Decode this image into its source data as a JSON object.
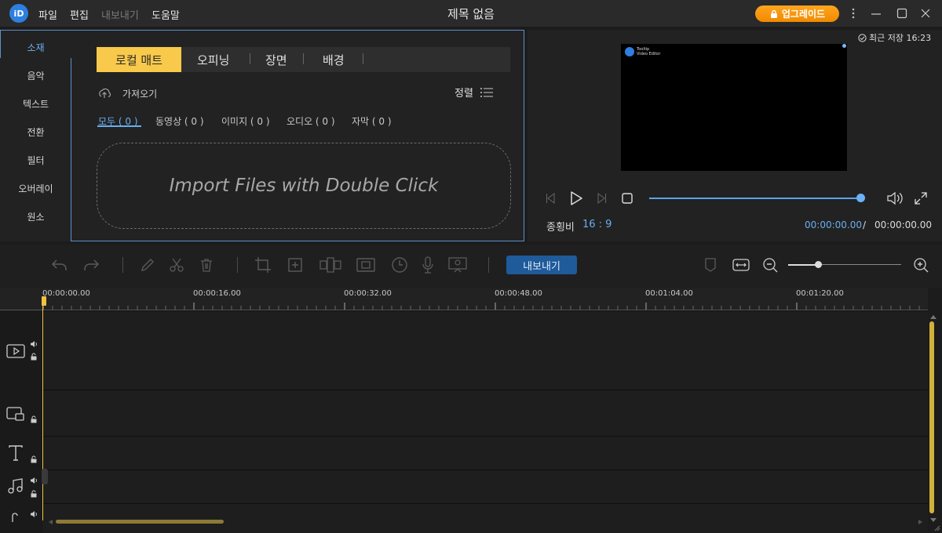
{
  "app": {
    "logo_text": "iD",
    "title": "제목 없음",
    "menu": [
      "파일",
      "편집",
      "내보내기",
      "도움말"
    ],
    "upgrade_label": "업그레이드"
  },
  "media": {
    "side_tabs": [
      "소재",
      "음악",
      "텍스트",
      "전환",
      "필터",
      "오버레이",
      "원소"
    ],
    "tabs": [
      "로컬 매트",
      "오피닝",
      "장면",
      "배경"
    ],
    "import_label": "가져오기",
    "sort_label": "정렬",
    "filters": [
      "모두 ( 0 )",
      "동영상 ( 0 )",
      "이미지 ( 0 )",
      "오디오 ( 0 )",
      "자막 ( 0 )"
    ],
    "dropzone_text": "Import Files with Double Click"
  },
  "preview": {
    "save_status": "최근 저장 16:23",
    "watermark_line1": "Tooltip",
    "watermark_line2": "Video Editor",
    "aspect_label": "종횡비",
    "aspect_value": "16 : 9",
    "time_current": "00:00:00.00",
    "time_sep": "/",
    "time_total": "00:00:00.00",
    "progress": 1.0
  },
  "timeline": {
    "export_label": "내보내기",
    "ruler_labels": [
      "00:00:00.00",
      "00:00:16.00",
      "00:00:32.00",
      "00:00:48.00",
      "00:01:04.00",
      "00:01:20.00"
    ],
    "zoom_level": 0.27
  }
}
